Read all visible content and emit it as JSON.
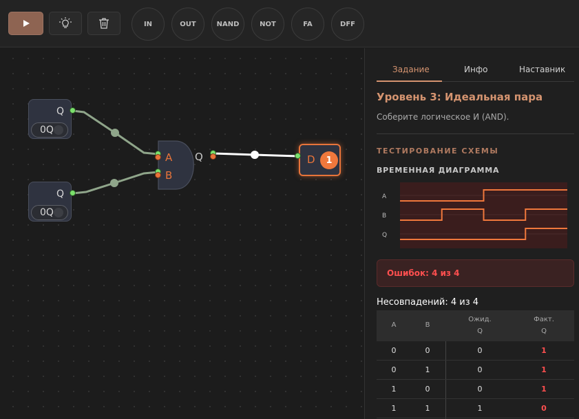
{
  "toolbar": {
    "run_icon": "play-icon",
    "light_icon": "lightbulb-icon",
    "trash_icon": "trash-icon",
    "components": [
      "IN",
      "OUT",
      "NAND",
      "NOT",
      "FA",
      "DFF"
    ]
  },
  "canvas": {
    "input_a": {
      "port_label": "Q",
      "toggle_label": "0Q"
    },
    "input_b": {
      "port_label": "Q",
      "toggle_label": "0Q"
    },
    "gate": {
      "in_a": "A",
      "in_b": "B",
      "out": "Q"
    },
    "output": {
      "port_label": "D",
      "badge": "1"
    }
  },
  "panel": {
    "tabs": [
      "Задание",
      "Инфо",
      "Наставник"
    ],
    "active_tab": "Задание",
    "level_title": "Уровень 3: Идеальная пара",
    "level_desc": "Соберите логическое И (AND).",
    "section_title": "ТЕСТИРОВАНИЕ СХЕМЫ",
    "timing_title": "ВРЕМЕННАЯ ДИАГРАММА",
    "timing": {
      "signals": [
        {
          "name": "A",
          "levels": [
            0,
            0,
            1,
            1
          ]
        },
        {
          "name": "B",
          "levels": [
            0,
            1,
            0,
            1
          ]
        },
        {
          "name": "Q",
          "levels": [
            0,
            0,
            0,
            1
          ]
        }
      ]
    },
    "error_text": "Ошибок: 4 из 4",
    "mismatch_text": "Несовпадений: 4 из 4",
    "table": {
      "headers": [
        "A",
        "B",
        "Ожид.",
        "Q",
        "Факт.",
        "Q"
      ],
      "rows": [
        [
          "0",
          "0",
          "0",
          "1"
        ],
        [
          "0",
          "1",
          "0",
          "1"
        ],
        [
          "1",
          "0",
          "0",
          "1"
        ],
        [
          "1",
          "1",
          "1",
          "0"
        ]
      ]
    },
    "colors": {
      "accent": "#d59470",
      "error": "#ff4f4f",
      "wave": "#f0783c"
    }
  }
}
